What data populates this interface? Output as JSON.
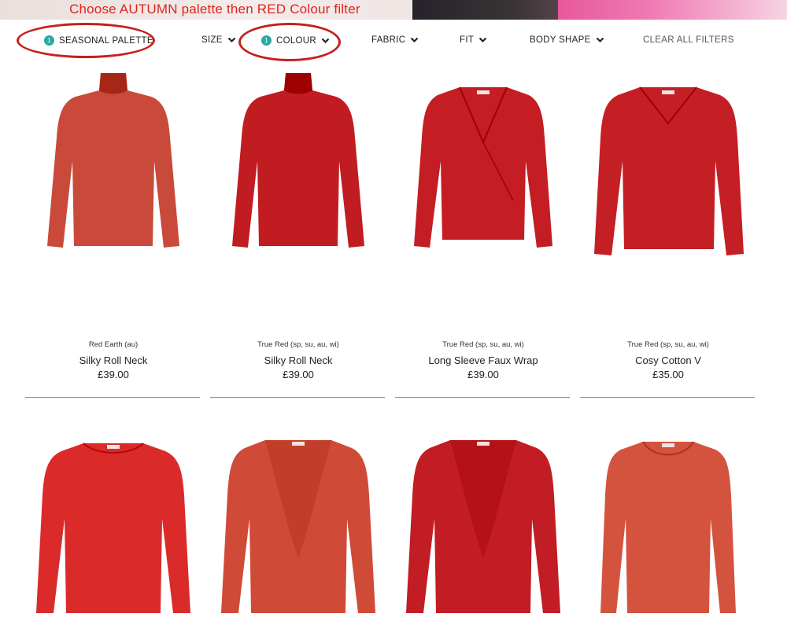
{
  "banner": {
    "instruction": "Choose AUTUMN palette then RED Colour filter"
  },
  "filters": [
    {
      "label": "SEASONAL PALETTE",
      "badge": "1",
      "has_chevron": false
    },
    {
      "label": "SIZE",
      "badge": null,
      "has_chevron": true
    },
    {
      "label": "COLOUR",
      "badge": "1",
      "has_chevron": true
    },
    {
      "label": "FABRIC",
      "badge": null,
      "has_chevron": true
    },
    {
      "label": "FIT",
      "badge": null,
      "has_chevron": true
    },
    {
      "label": "BODY SHAPE",
      "badge": null,
      "has_chevron": true
    }
  ],
  "clear_filters_label": "CLEAR ALL FILTERS",
  "colors": {
    "accent_badge": "#2aa9a0",
    "annotation_red": "#c5201c"
  },
  "products": [
    {
      "swatch": "Red Earth (au)",
      "name": "Silky Roll Neck",
      "price": "£39.00",
      "garment_color": "#c94a3a",
      "style": "rollneck"
    },
    {
      "swatch": "True Red (sp, su, au, wi)",
      "name": "Silky Roll Neck",
      "price": "£39.00",
      "garment_color": "#c01c22",
      "style": "rollneck"
    },
    {
      "swatch": "True Red (sp, su, au, wi)",
      "name": "Long Sleeve Faux Wrap",
      "price": "£39.00",
      "garment_color": "#c41d24",
      "style": "wrap"
    },
    {
      "swatch": "True Red (sp, su, au, wi)",
      "name": "Cosy Cotton V",
      "price": "£35.00",
      "garment_color": "#c41f25",
      "style": "vneck"
    },
    {
      "swatch": "",
      "name": "",
      "price": "",
      "garment_color": "#db2a2a",
      "style": "crew"
    },
    {
      "swatch": "",
      "name": "",
      "price": "",
      "garment_color": "#cf4a37",
      "style": "tie"
    },
    {
      "swatch": "",
      "name": "",
      "price": "",
      "garment_color": "#c21c24",
      "style": "tie"
    },
    {
      "swatch": "",
      "name": "",
      "price": "",
      "garment_color": "#d4533f",
      "style": "scoop"
    }
  ]
}
